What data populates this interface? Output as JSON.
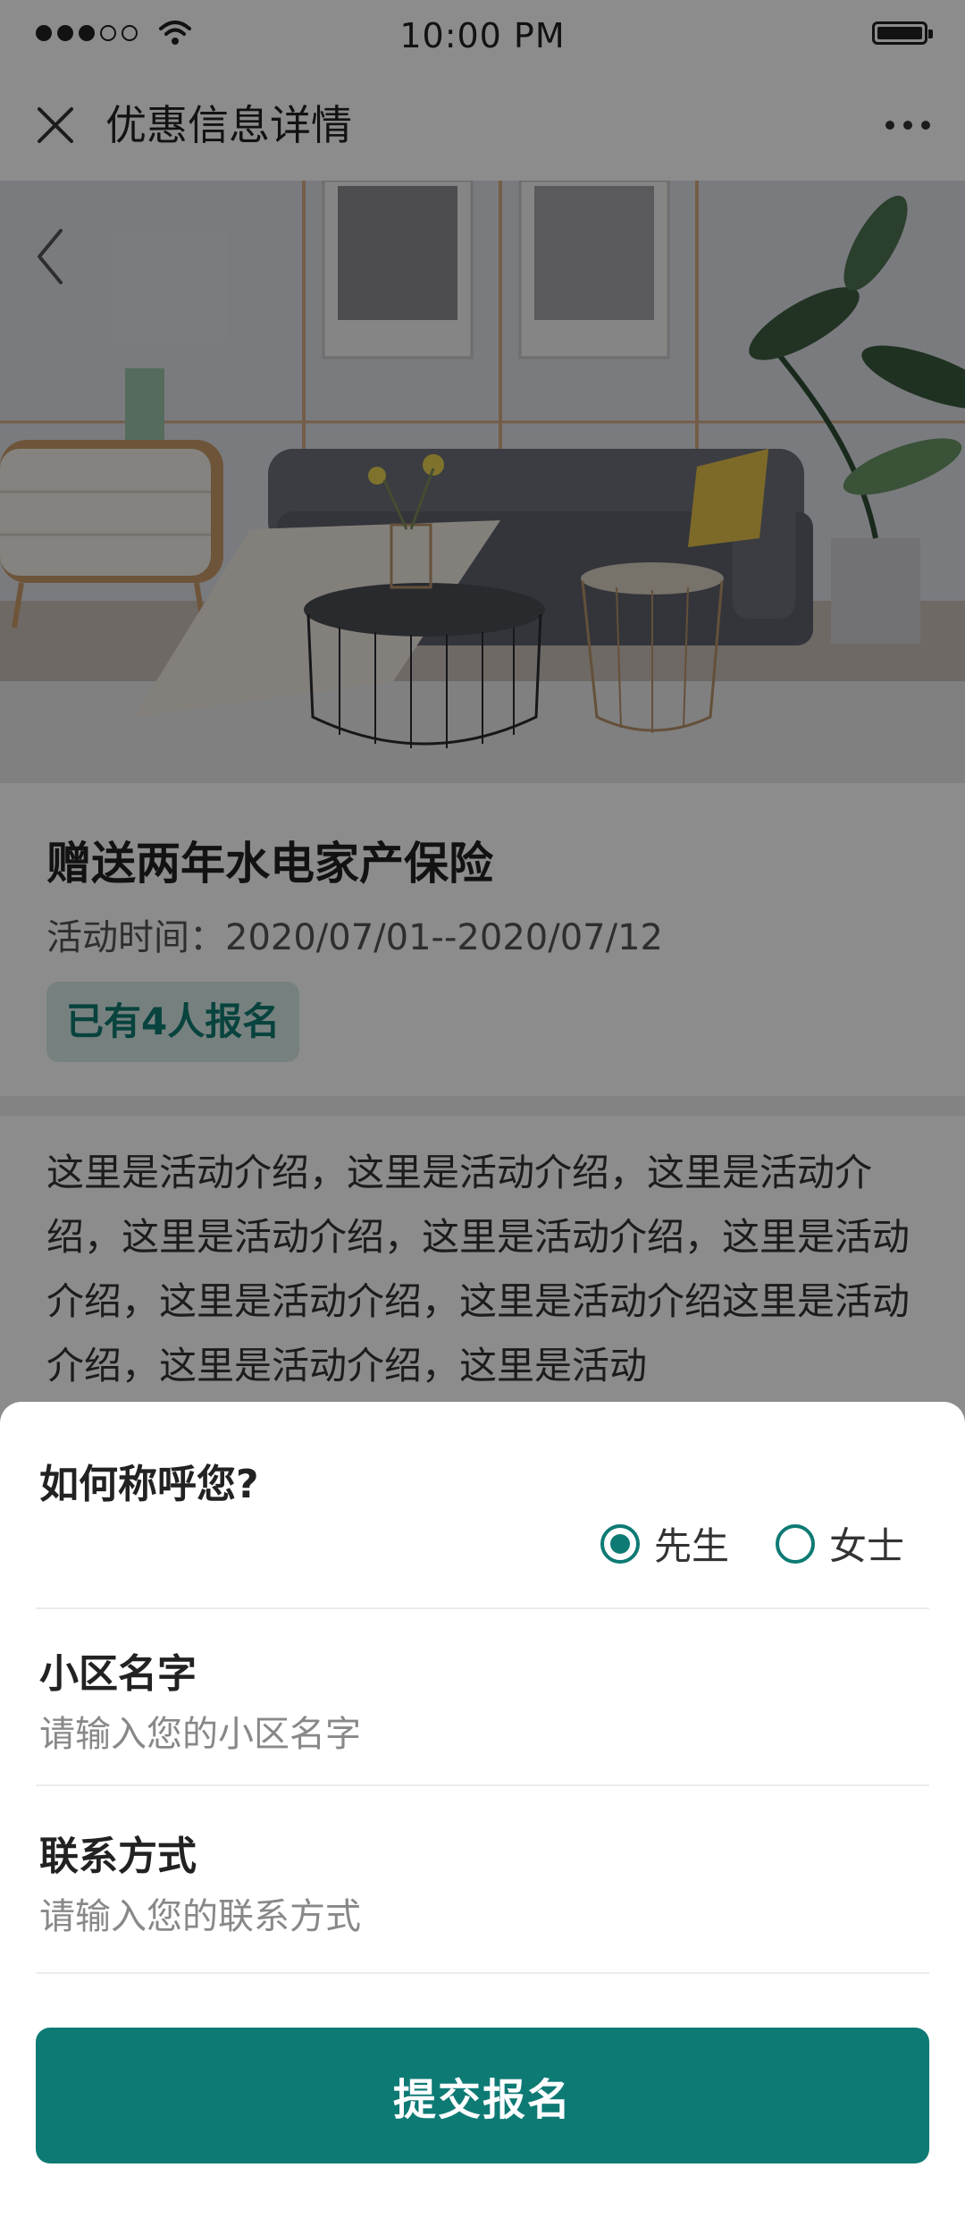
{
  "status_bar": {
    "time": "10:00 PM"
  },
  "nav": {
    "title": "优惠信息详情"
  },
  "promo": {
    "title": "赠送两年水电家产保险",
    "time_label": "活动时间：",
    "time_range": "2020/07/01--2020/07/12",
    "signup_badge": "已有4人报名"
  },
  "description": {
    "text": "这里是活动介绍，这里是活动介绍，这里是活动介绍，这里是活动介绍，这里是活动介绍，这里是活动介绍，这里是活动介绍，这里是活动介绍这里是活动介绍，这里是活动介绍，这里是活动"
  },
  "form": {
    "salutation_question": "如何称呼您?",
    "options": [
      {
        "label": "先生",
        "selected": true
      },
      {
        "label": "女士",
        "selected": false
      }
    ],
    "community_label": "小区名字",
    "community_placeholder": "请输入您的小区名字",
    "contact_label": "联系方式",
    "contact_placeholder": "请输入您的联系方式",
    "submit_label": "提交报名"
  },
  "colors": {
    "accent": "#0e7a74",
    "badge_bg": "#d7ebe8"
  }
}
